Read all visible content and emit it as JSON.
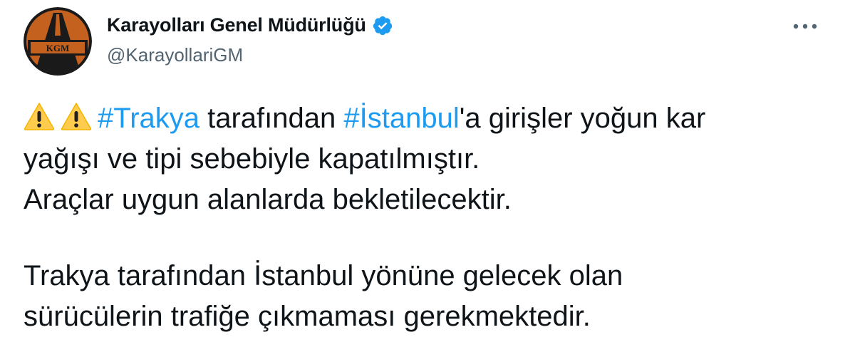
{
  "header": {
    "display_name": "Karayolları Genel Müdürlüğü",
    "handle": "@KarayollariGM",
    "avatar_text": "KGM",
    "more_icon": "more-horizontal-icon",
    "verified_icon": "verified-badge-icon"
  },
  "colors": {
    "hashtag": "#1d9bf0",
    "verified": "#1d9bf0",
    "text": "#0f1419",
    "handle": "#536471",
    "warning": "#ffcc4d"
  },
  "tweet": {
    "line1": {
      "hashtag1": "#Trakya",
      "text1": " tarafından ",
      "hashtag2": "#İstanbul",
      "text2": "'a girişler yoğun kar"
    },
    "line2": "yağışı ve tipi sebebiyle kapatılmıştır.",
    "line3": "Araçlar uygun alanlarda bekletilecektir.",
    "line4": "Trakya tarafından İstanbul yönüne gelecek olan",
    "line5": "sürücülerin trafiğe çıkmaması gerekmektedir."
  }
}
